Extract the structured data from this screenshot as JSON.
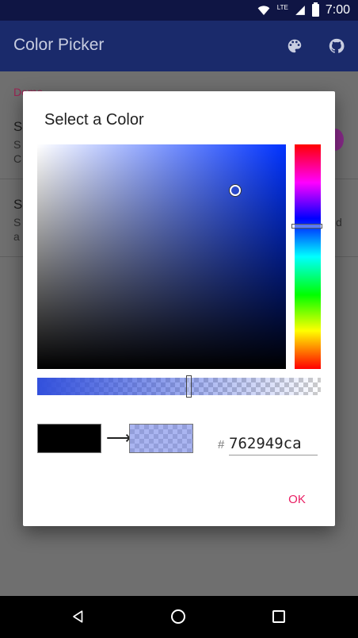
{
  "status_bar": {
    "time": "7:00",
    "network_label": "LTE"
  },
  "app_bar": {
    "title": "Color Picker",
    "icons": [
      "palette-icon",
      "github-icon"
    ]
  },
  "list": {
    "section_header": "Demo",
    "row1": {
      "title": "S",
      "sub1": "S",
      "sub2": "C"
    },
    "row2": {
      "title": "S",
      "sub1": "S",
      "sub2": "a",
      "tail1": "d"
    }
  },
  "dialog": {
    "title": "Select a Color",
    "hex_prefix": "#",
    "hex_value": "762949ca",
    "ok_label": "OK",
    "alpha_level": 0.55,
    "selected_hue_position": 0.36
  },
  "colors": {
    "accent": "#e91e63",
    "app_bar": "#1a2a6b",
    "status_bar": "#0f1544"
  }
}
